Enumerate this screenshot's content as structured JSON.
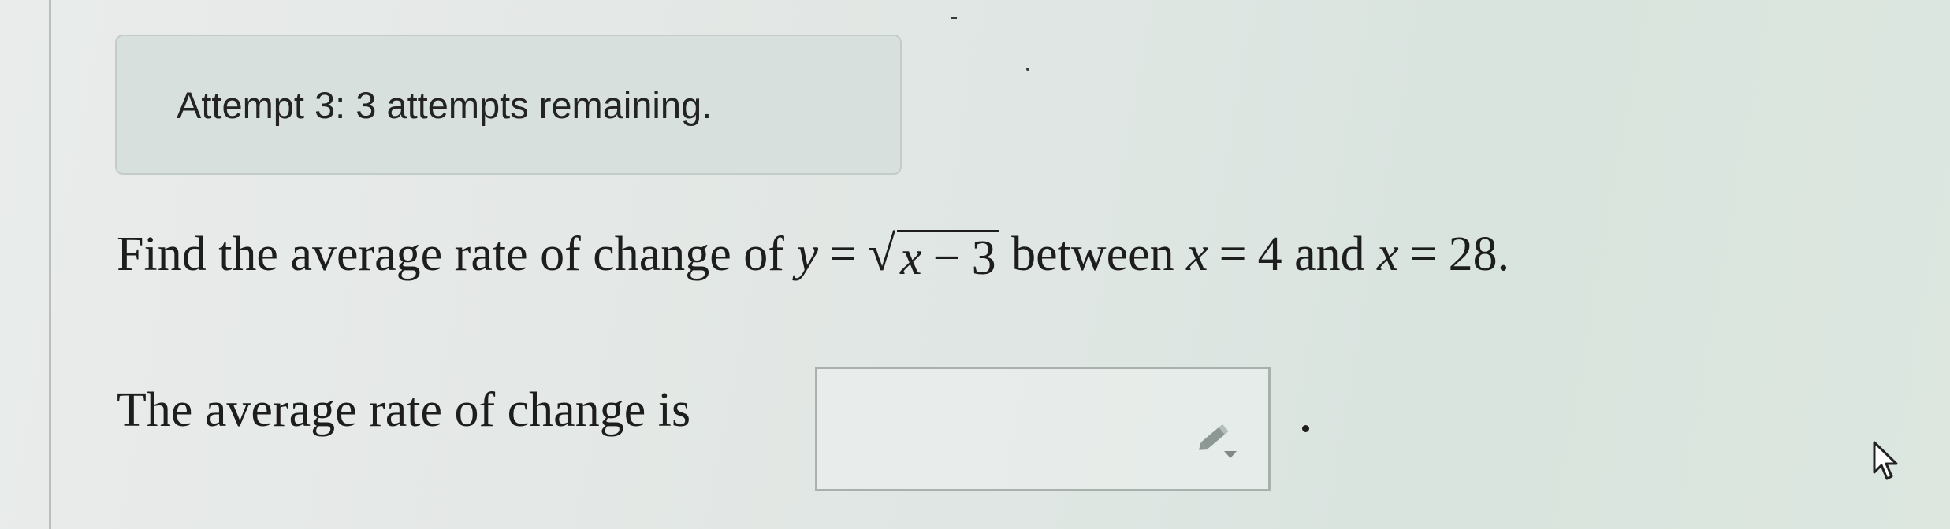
{
  "attempt_banner": {
    "text": "Attempt 3: 3 attempts remaining."
  },
  "question": {
    "prefix": "Find the average rate of change of",
    "y_var": "y",
    "equals": "=",
    "sqrt_var": "x",
    "sqrt_minus": "−",
    "sqrt_const": "3",
    "between": "between",
    "x_var_1": "x",
    "x_value_1": "4",
    "and": "and",
    "x_var_2": "x",
    "x_value_2": "28",
    "end": "."
  },
  "answer": {
    "prompt": "The average rate of change is",
    "value": "",
    "trailing_period": "."
  },
  "icons": {
    "pencil": "pencil-dropdown-icon",
    "cursor": "mouse-pointer-icon"
  }
}
